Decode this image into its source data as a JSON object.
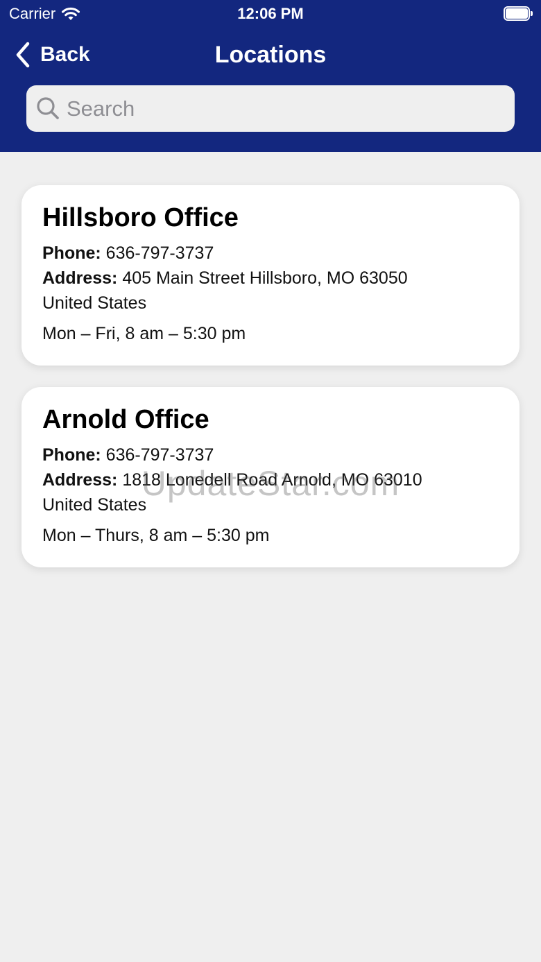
{
  "status_bar": {
    "carrier": "Carrier",
    "time": "12:06 PM"
  },
  "nav": {
    "back_label": "Back",
    "title": "Locations"
  },
  "search": {
    "placeholder": "Search",
    "value": ""
  },
  "locations": [
    {
      "name": "Hillsboro Office",
      "phone_label": "Phone:",
      "phone": "636-797-3737",
      "address_label": "Address:",
      "address": "405 Main Street Hillsboro, MO 63050",
      "country": "United States",
      "hours": "Mon – Fri, 8 am – 5:30 pm"
    },
    {
      "name": "Arnold Office",
      "phone_label": "Phone:",
      "phone": "636-797-3737",
      "address_label": "Address:",
      "address": "1818 Lonedell Road Arnold, MO 63010",
      "country": "United States",
      "hours": "Mon – Thurs, 8 am – 5:30 pm"
    }
  ],
  "watermark": "UpdateStar.com",
  "colors": {
    "header_bg": "#13277f",
    "page_bg": "#efefef",
    "card_bg": "#ffffff"
  },
  "icons": [
    "wifi-icon",
    "battery-icon",
    "chevron-left-icon",
    "search-icon"
  ]
}
